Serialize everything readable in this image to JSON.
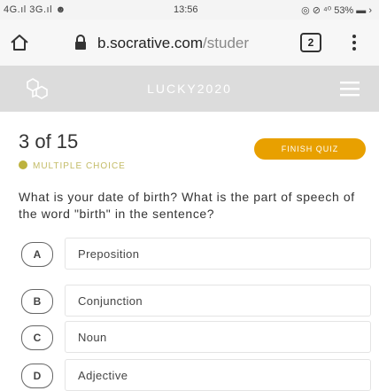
{
  "status_bar": {
    "left": "4G.ıl 3G.ıl ☻",
    "time": "13:56",
    "right": "◎ ⊘ ⁴⁰ 53% ▬ ›"
  },
  "browser": {
    "url_domain": "b.socrative.com",
    "url_path": "/studer",
    "tab_count": "2"
  },
  "app_header": {
    "room_name": "LUCKY2020"
  },
  "quiz": {
    "progress": "3 of 15",
    "question_type": "MULTIPLE CHOICE",
    "finish_label": "FINISH QUIZ",
    "question": "What is your date of birth? What is the part of speech of the word \"birth\" in the sentence?",
    "answers": [
      {
        "letter": "A",
        "text": "Preposition"
      },
      {
        "letter": "B",
        "text": "Conjunction"
      },
      {
        "letter": "C",
        "text": "Noun"
      },
      {
        "letter": "D",
        "text": "Adjective"
      }
    ]
  },
  "colors": {
    "accent": "#e8a000",
    "type_dot": "#bdb23d",
    "header_bg": "#dcdcdc"
  }
}
